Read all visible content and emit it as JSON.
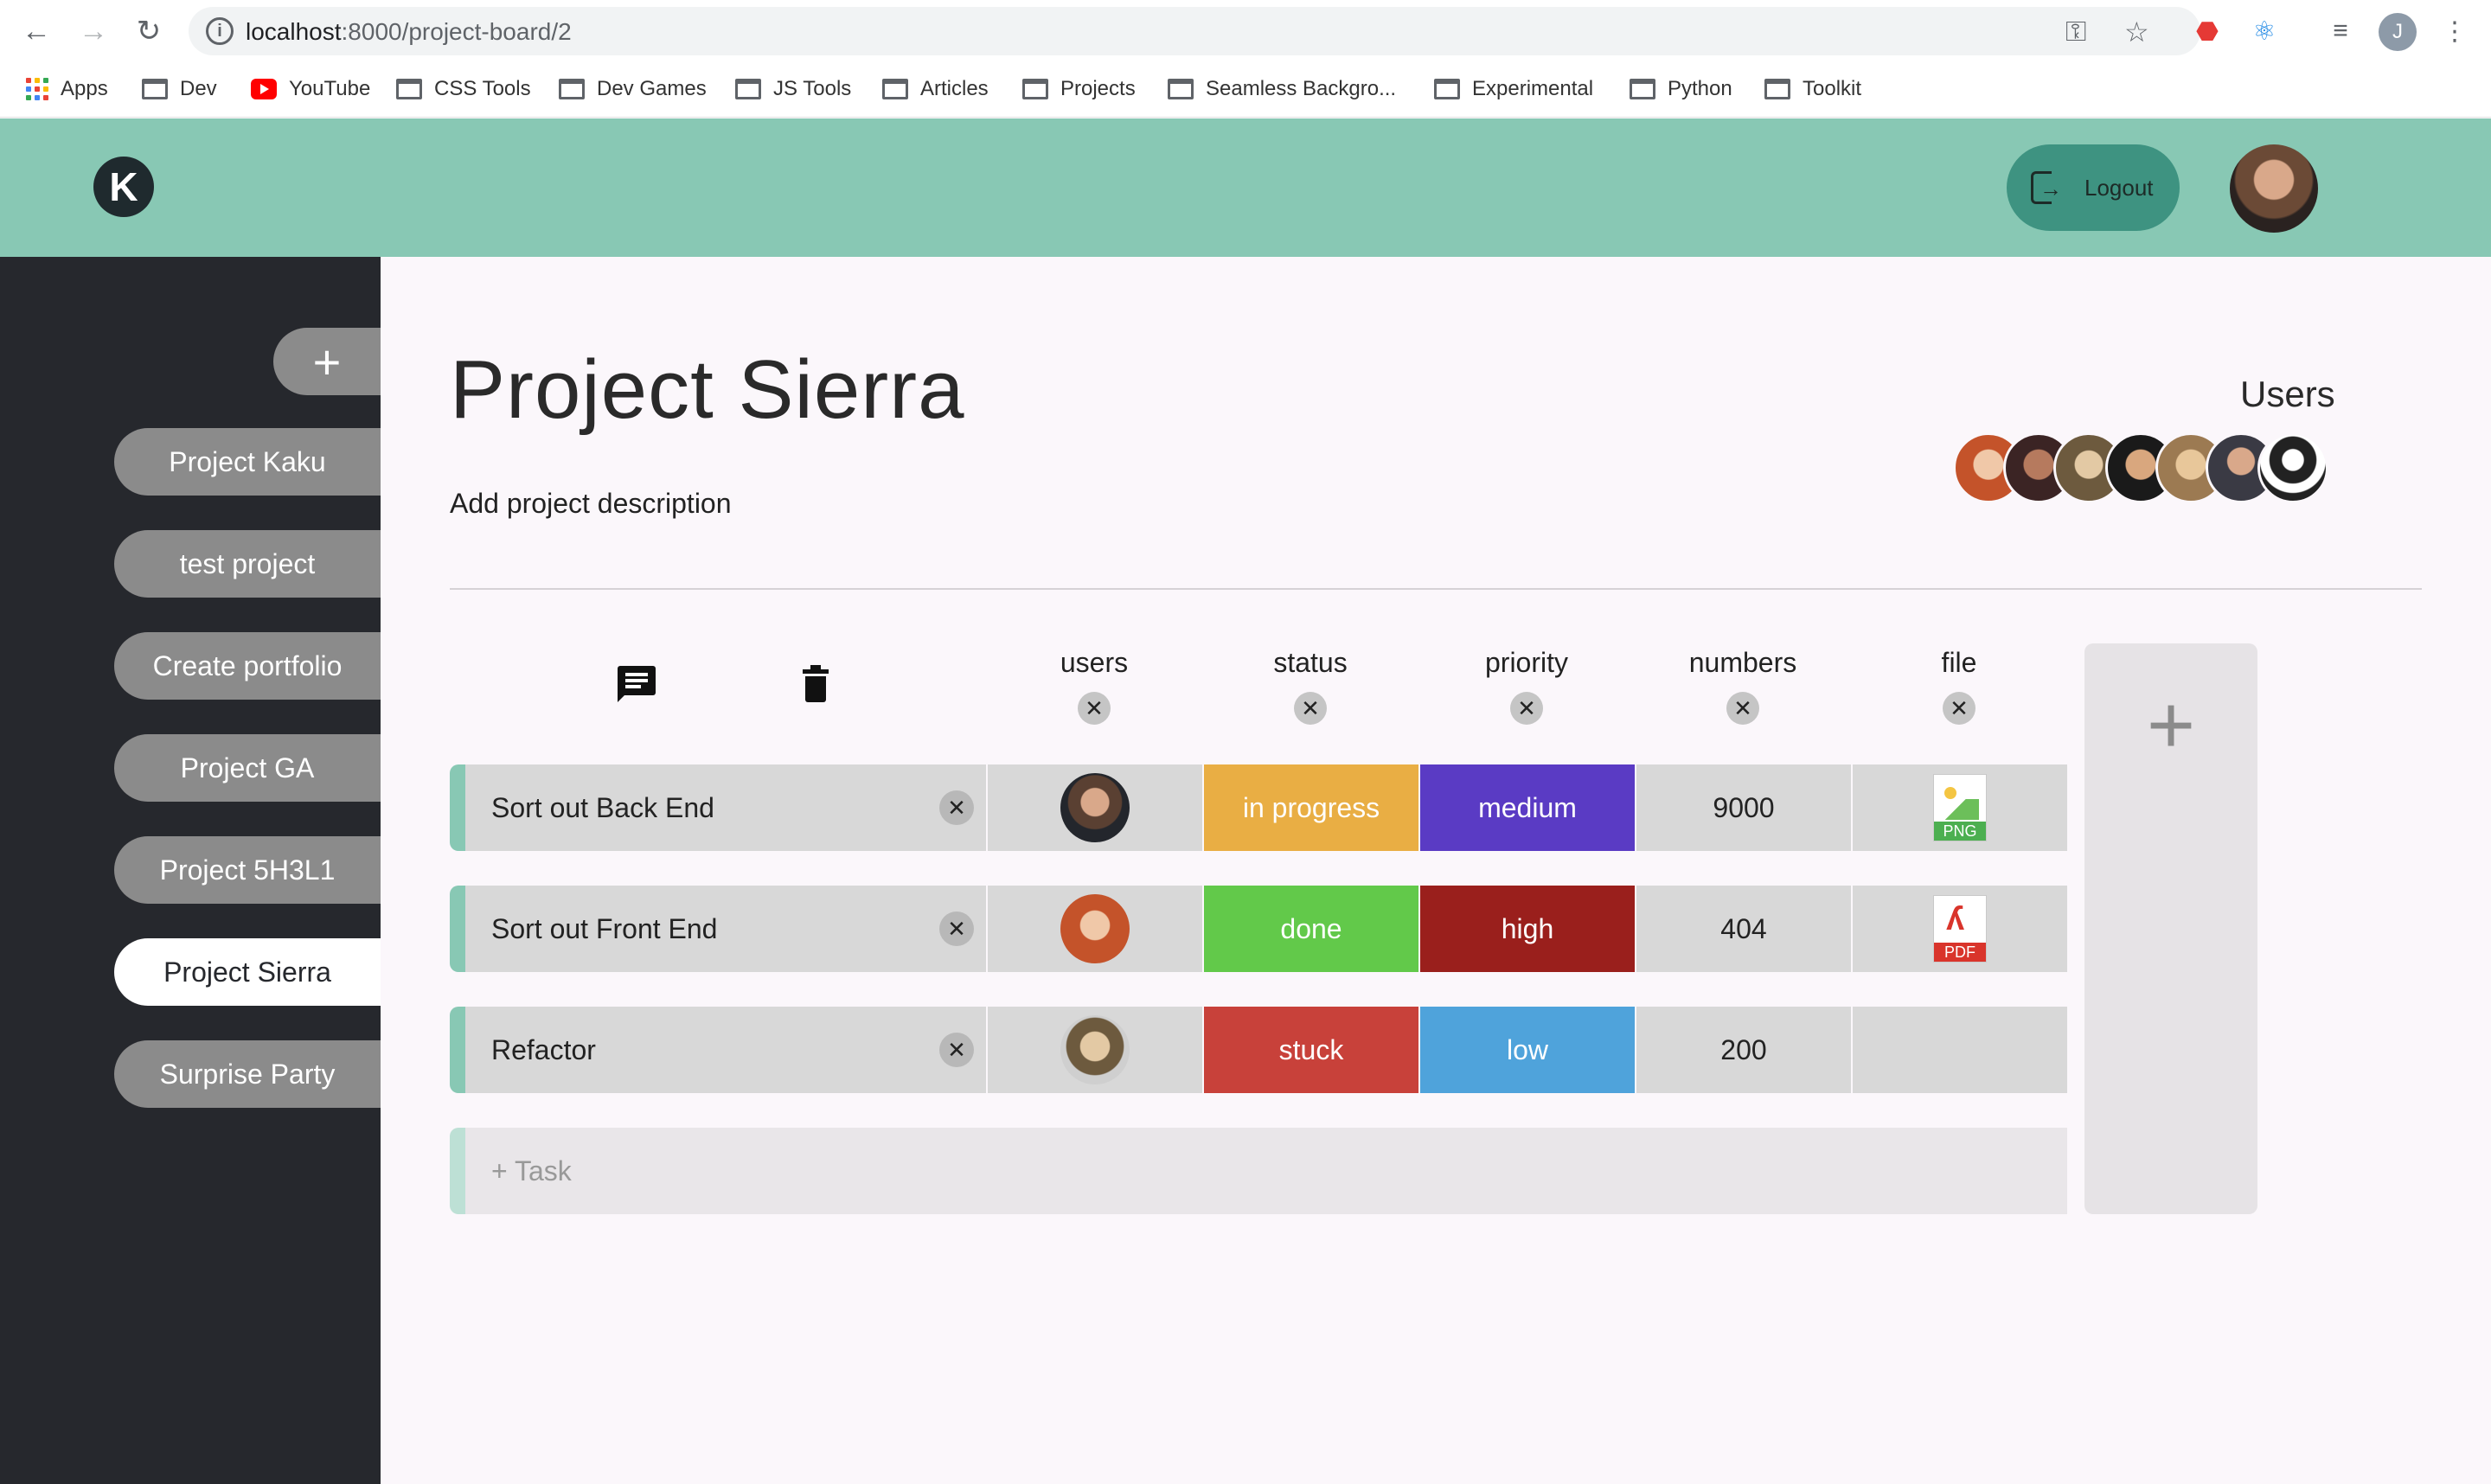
{
  "browser": {
    "url_host": "localhost",
    "url_path": ":8000/project-board/2",
    "profile_initial": "J",
    "bookmarks": [
      {
        "label": "Apps",
        "icon": "apps-grid-icon"
      },
      {
        "label": "Dev",
        "icon": "folder-icon"
      },
      {
        "label": "YouTube",
        "icon": "youtube-icon"
      },
      {
        "label": "CSS Tools",
        "icon": "folder-icon"
      },
      {
        "label": "Dev Games",
        "icon": "folder-icon"
      },
      {
        "label": "JS Tools",
        "icon": "folder-icon"
      },
      {
        "label": "Articles",
        "icon": "folder-icon"
      },
      {
        "label": "Projects",
        "icon": "folder-icon"
      },
      {
        "label": "Seamless Backgro...",
        "icon": "folder-icon"
      },
      {
        "label": "Experimental",
        "icon": "folder-icon"
      },
      {
        "label": "Python",
        "icon": "folder-icon"
      },
      {
        "label": "Toolkit",
        "icon": "folder-icon"
      }
    ]
  },
  "header": {
    "logo_glyph": "K",
    "logout_label": "Logout",
    "accent_color": "#88c8b4"
  },
  "sidebar": {
    "add_label": "+",
    "projects": [
      {
        "label": "Project Kaku",
        "active": false
      },
      {
        "label": "test project",
        "active": false
      },
      {
        "label": "Create portfolio",
        "active": false
      },
      {
        "label": "Project GA",
        "active": false
      },
      {
        "label": "Project 5H3L1",
        "active": false
      },
      {
        "label": "Project Sierra",
        "active": true
      },
      {
        "label": "Surprise Party",
        "active": false
      }
    ]
  },
  "main": {
    "title": "Project Sierra",
    "description": "Add project description",
    "users_title": "Users",
    "columns": [
      "users",
      "status",
      "priority",
      "numbers",
      "file"
    ],
    "tasks": [
      {
        "name": "Sort out Back End",
        "status": "in progress",
        "status_color": "#e9ae44",
        "priority": "medium",
        "priority_color": "#5a3bc4",
        "number": "9000",
        "file": "PNG"
      },
      {
        "name": "Sort out Front End",
        "status": "done",
        "status_color": "#62c94a",
        "priority": "high",
        "priority_color": "#9a1f1c",
        "number": "404",
        "file": "PDF"
      },
      {
        "name": "Refactor",
        "status": "stuck",
        "status_color": "#c8413a",
        "priority": "low",
        "priority_color": "#4fa3db",
        "number": "200",
        "file": ""
      }
    ],
    "add_task_placeholder": "+ Task",
    "add_column_label": "+"
  }
}
